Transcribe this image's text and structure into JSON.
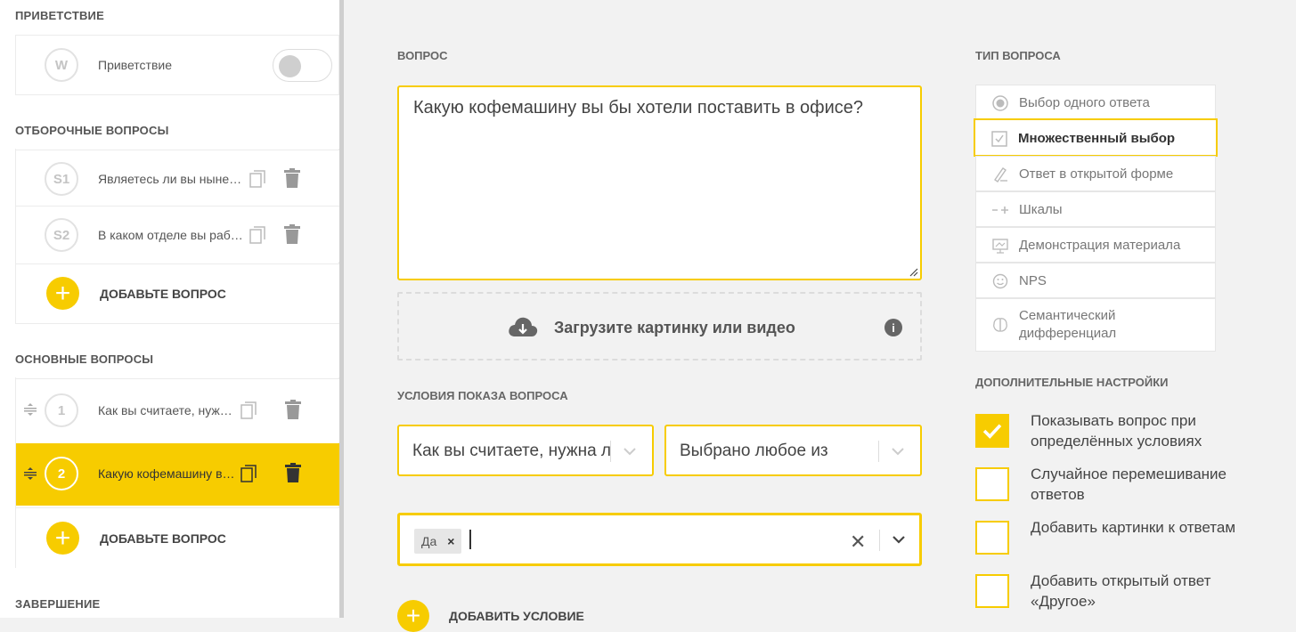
{
  "sidebar": {
    "welcome_title": "Приветствие",
    "welcome_item": {
      "badge": "W",
      "label": "Приветствие"
    },
    "screening_title": "Отборочные вопросы",
    "screening_items": [
      {
        "badge": "S1",
        "text": "Являетесь ли вы нынешним сотрудником"
      },
      {
        "badge": "S2",
        "text": "В каком отделе вы работаете"
      }
    ],
    "add_question_label": "Добавьте вопрос",
    "main_title": "Основные вопросы",
    "main_items": [
      {
        "badge": "1",
        "text": "Как вы считаете, нужна ли в офисе"
      },
      {
        "badge": "2",
        "text": "Какую кофемашину вы бы хотели"
      }
    ],
    "finish_title": "Завершение"
  },
  "editor": {
    "question_label": "Вопрос",
    "question_text": "Какую кофемашину вы бы хотели поставить в офисе?",
    "upload_label": "Загрузите картинку или видео",
    "info_glyph": "i",
    "conditions_label": "Условия показа вопроса",
    "condition_question": "Как вы считаете, нужна ли в офисе",
    "condition_operator": "Выбрано любое из",
    "condition_tag": "Да",
    "tag_remove_glyph": "×",
    "clear_glyph": "✕",
    "add_condition_label": "Добавить условие"
  },
  "question_type": {
    "title": "Тип вопроса",
    "items": [
      {
        "label": "Выбор одного ответа",
        "icon": "radio-icon"
      },
      {
        "label": "Множественный выбор",
        "icon": "checkbox-icon",
        "selected": true
      },
      {
        "label": "Ответ в открытой форме",
        "icon": "pen-icon"
      },
      {
        "label": "Шкалы",
        "icon": "scale-icon"
      },
      {
        "label": "Демонстрация материала",
        "icon": "presentation-icon"
      },
      {
        "label": "NPS",
        "icon": "nps-icon"
      },
      {
        "label": "Семантический дифференциал",
        "icon": "brain-icon"
      }
    ]
  },
  "extra_settings": {
    "title": "Дополнительные настройки",
    "options": [
      {
        "label": "Показывать вопрос при определённых условиях",
        "checked": true
      },
      {
        "label": "Случайное перемешивание ответов",
        "checked": false
      },
      {
        "label": "Добавить картинки к ответам",
        "checked": false
      },
      {
        "label": "Добавить открытый ответ «Другое»",
        "checked": false
      }
    ]
  },
  "colors": {
    "accent": "#f7cc00",
    "background": "#f2f2f2"
  }
}
